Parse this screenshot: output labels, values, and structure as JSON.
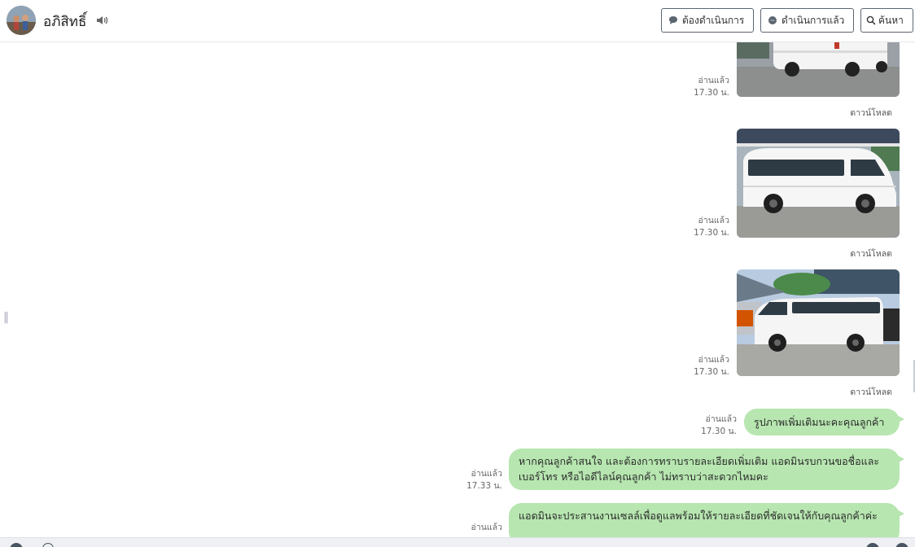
{
  "header": {
    "contact_name": "อภิสิทธิ์",
    "btn_pending": "ต้องดำเนินการ",
    "btn_done": "ดำเนินการแล้ว",
    "btn_search": "ค้นหา"
  },
  "messages": [
    {
      "read": "อ่านแล้ว",
      "time": "17.30 น.",
      "download": "ดาวน์โหลด"
    },
    {
      "read": "อ่านแล้ว",
      "time": "17.30 น.",
      "download": "ดาวน์โหลด"
    },
    {
      "read": "อ่านแล้ว",
      "time": "17.30 น.",
      "download": "ดาวน์โหลด"
    },
    {
      "read": "อ่านแล้ว",
      "time": "17.30 น.",
      "text": "รูปภาพเพิ่มเติมนะคะคุณลูกค้า"
    },
    {
      "read": "อ่านแล้ว",
      "time": "17.33 น.",
      "text": "หากคุณลูกค้าสนใจ และต้องการทราบรายละเอียดเพิ่มเติม แอดมินรบกวนขอชื่อและเบอร์โทร หรือไอดีไลน์คุณลูกค้า ไม่ทราบว่าสะดวกไหมคะ"
    },
    {
      "read": "อ่านแล้ว",
      "text": "แอดมินจะประสานงานเซลล์เพื่อดูแลพร้อมให้รายละเอียดที่ชัดเจนให้กับคุณลูกค้าค่ะ"
    }
  ],
  "colors": {
    "bubble": "#b7e6b0",
    "header_border": "#e3e6ea"
  }
}
